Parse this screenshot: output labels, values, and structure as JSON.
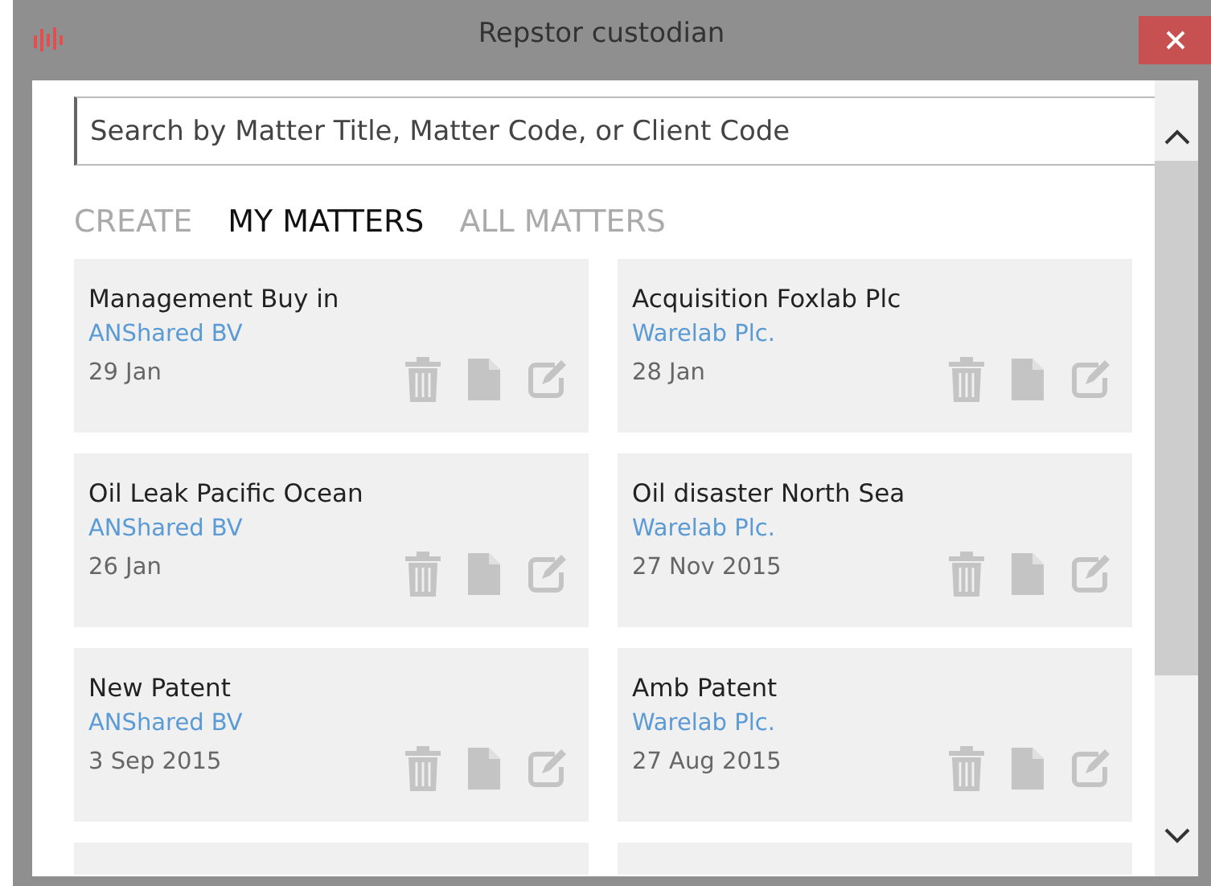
{
  "window": {
    "title": "Repstor custodian"
  },
  "search": {
    "placeholder": "Search by Matter Title, Matter Code, or Client Code"
  },
  "tabs": [
    {
      "label": "CREATE",
      "selected": false
    },
    {
      "label": "MY MATTERS",
      "selected": true
    },
    {
      "label": "ALL MATTERS",
      "selected": false
    }
  ],
  "matters": [
    {
      "title": "Management Buy in",
      "client": "ANShared BV",
      "date": "29 Jan"
    },
    {
      "title": "Acquisition Foxlab Plc",
      "client": "Warelab Plc.",
      "date": "28 Jan"
    },
    {
      "title": "Oil Leak Pacific Ocean",
      "client": "ANShared BV",
      "date": "26 Jan"
    },
    {
      "title": "Oil disaster North Sea",
      "client": "Warelab Plc.",
      "date": "27 Nov 2015"
    },
    {
      "title": "New Patent",
      "client": "ANShared BV",
      "date": "3 Sep 2015"
    },
    {
      "title": "Amb Patent",
      "client": "Warelab Plc.",
      "date": "27 Aug 2015"
    }
  ]
}
